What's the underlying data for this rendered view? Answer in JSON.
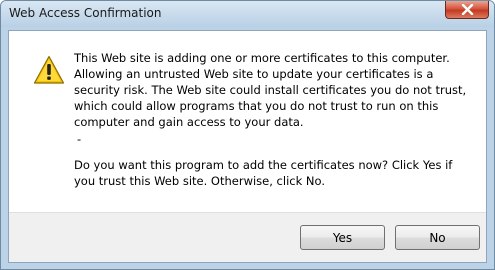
{
  "dialog": {
    "title": "Web Access Confirmation",
    "icon": "warning-icon",
    "message_paragraph_1": "This Web site is adding one or more certificates to this computer. Allowing an untrusted Web site to update your certificates is a security risk. The Web site could install certificates you do not trust, which could allow programs that you do not trust to run on this computer and gain access to your data.",
    "message_dash": "-",
    "message_paragraph_2": "Do you want this program to add the certificates now? Click Yes if you trust this Web site. Otherwise, click No.",
    "yes_label": "Yes",
    "no_label": "No"
  },
  "colors": {
    "frame": "#bcd2e6",
    "close_button": "#c23a22",
    "warning_fill": "#f5c400"
  }
}
